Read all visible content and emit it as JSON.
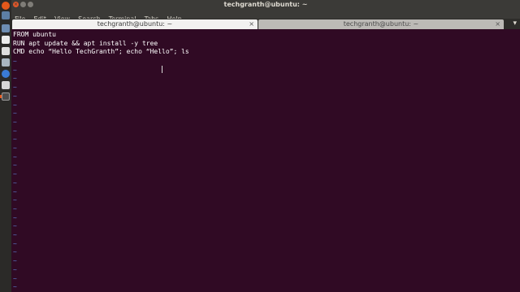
{
  "window": {
    "title": "techgranth@ubuntu: ~"
  },
  "menu": {
    "items": [
      "File",
      "Edit",
      "View",
      "Search",
      "Terminal",
      "Tabs",
      "Help"
    ]
  },
  "tabs": [
    {
      "label": "techgranth@ubuntu: ~",
      "active": true
    },
    {
      "label": "techgranth@ubuntu: ~",
      "active": false
    }
  ],
  "editor": {
    "lines": [
      "FROM ubuntu",
      "RUN apt update && apt install -y tree",
      "CMD echo “Hello TechGranth”; echo “Hello”; ls"
    ],
    "empty_marker": "~"
  },
  "colors": {
    "terminal_bg": "#300a24",
    "tilde": "#5b78c8",
    "accent": "#e2582a"
  }
}
